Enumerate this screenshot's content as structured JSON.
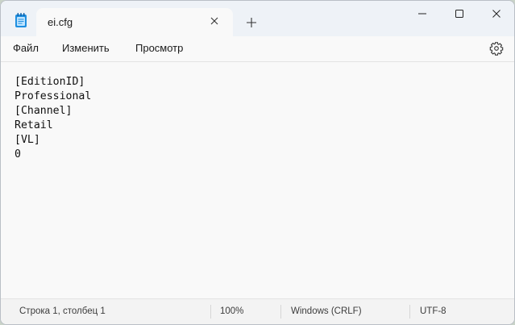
{
  "window": {
    "tab_title": "ei.cfg",
    "icons": {
      "app": "notepad-icon",
      "tab_close": "close-icon",
      "new_tab": "plus-icon",
      "minimize": "minimize-icon",
      "maximize": "maximize-icon",
      "close": "close-icon"
    }
  },
  "menu": {
    "file": "Файл",
    "edit": "Изменить",
    "view": "Просмотр",
    "settings_icon": "gear-icon"
  },
  "editor": {
    "content": "[EditionID]\nProfessional\n[Channel]\nRetail\n[VL]\n0"
  },
  "status": {
    "position": "Строка 1, столбец 1",
    "zoom": "100%",
    "line_endings": "Windows (CRLF)",
    "encoding": "UTF-8"
  },
  "colors": {
    "titlebar_bg": "#eef2f7",
    "editor_bg": "#f9f9f9",
    "app_icon_accent": "#1f8fe0"
  }
}
